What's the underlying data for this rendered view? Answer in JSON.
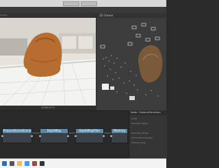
{
  "app": {
    "top_buttons": [
      "",
      ""
    ],
    "viewer_title": "/Users/...",
    "viewer3d_title": "3D Viewer",
    "viewer_footer": "4096x3072"
  },
  "graph": {
    "nodes": [
      {
        "label": "PrepareDenseScene"
      },
      {
        "label": "DepthMap"
      },
      {
        "label": "DepthMapFilter"
      },
      {
        "label": "Meshing"
      }
    ]
  },
  "panel": {
    "title": "Node : FeatureExtraction",
    "rows": [
      "Input",
      "Describer Types",
      "Describer Preset",
      "Force CPU Extraction",
      "Verbose Level"
    ]
  },
  "colors": {
    "node_header": "#5a8aa8",
    "background": "#2b2b2b"
  },
  "taskbar": {
    "icons": [
      "windows-icon",
      "search-icon",
      "folder-icon",
      "browser-icon",
      "app-icon",
      "terminal-icon"
    ]
  }
}
